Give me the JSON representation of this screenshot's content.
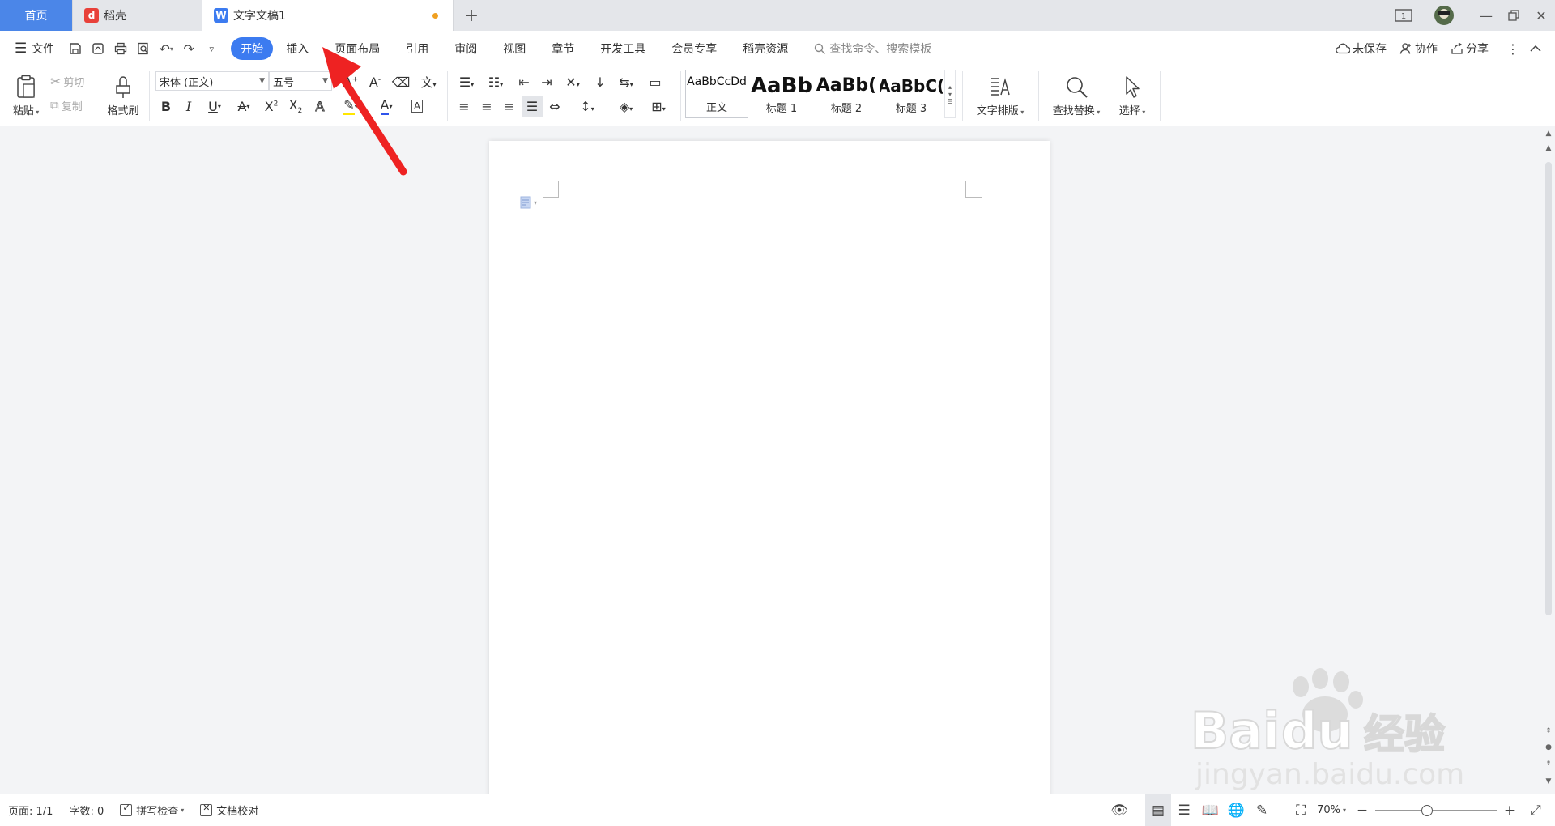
{
  "tabs": {
    "home": "首页",
    "daoke": "稻壳",
    "doc": "文字文稿1",
    "daoke_color": "#e8413a",
    "doc_color": "#3c7bf0"
  },
  "menu": {
    "file": "文件",
    "tabs": [
      "开始",
      "插入",
      "页面布局",
      "引用",
      "审阅",
      "视图",
      "章节",
      "开发工具",
      "会员专享",
      "稻壳资源"
    ],
    "active_tab": "开始",
    "search": "查找命令、搜索模板",
    "unsaved": "未保存",
    "collab": "协作",
    "share": "分享"
  },
  "ribbon": {
    "paste": "粘贴",
    "cut": "剪切",
    "copy": "复制",
    "format_painter": "格式刷",
    "font_name": "宋体 (正文)",
    "font_size": "五号",
    "styles": [
      {
        "preview": "AaBbCcDd",
        "name": "正文"
      },
      {
        "preview": "AaBb",
        "name": "标题 1"
      },
      {
        "preview": "AaBb(",
        "name": "标题 2"
      },
      {
        "preview": "AaBbC(",
        "name": "标题 3"
      }
    ],
    "text_layout": "文字排版",
    "find_replace": "查找替换",
    "select": "选择"
  },
  "status": {
    "page": "页面: 1/1",
    "words": "字数: 0",
    "spell_check": "拼写检查",
    "doc_proof": "文档校对",
    "zoom": "70%",
    "zoom_level": 0.42
  },
  "watermark": {
    "brand": "Bai",
    "brand_cn": "经验",
    "url": "jingyan.baidu.com"
  },
  "accent": "#3c7bf0",
  "arrow_color": "#ee2222"
}
